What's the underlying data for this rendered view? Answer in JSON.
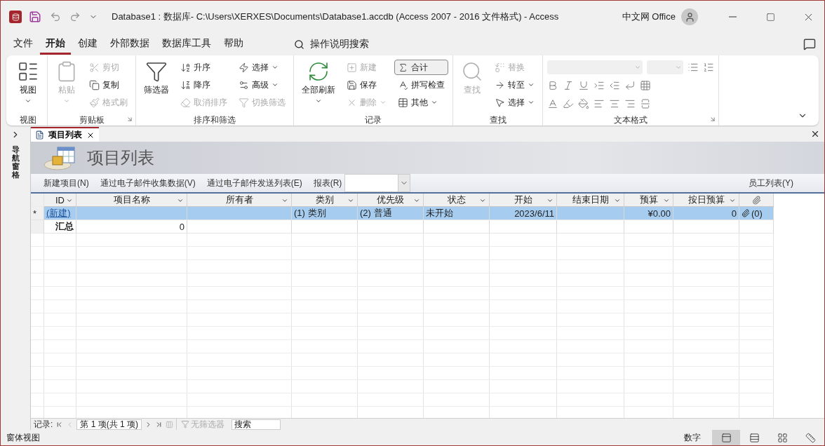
{
  "title_bar": {
    "title": "Database1 : 数据库- C:\\Users\\XERXES\\Documents\\Database1.accdb (Access 2007 - 2016 文件格式)  -  Access",
    "account": "中文网 Office"
  },
  "menu": {
    "tabs": [
      {
        "label": "文件",
        "selected": false
      },
      {
        "label": "开始",
        "selected": true
      },
      {
        "label": "创建",
        "selected": false
      },
      {
        "label": "外部数据",
        "selected": false
      },
      {
        "label": "数据库工具",
        "selected": false
      },
      {
        "label": "帮助",
        "selected": false
      }
    ],
    "search": "操作说明搜索"
  },
  "ribbon": {
    "groups": [
      {
        "kind": "buttons",
        "label": "视图",
        "launcher": false,
        "items": [
          {
            "kind": "large",
            "label": "视图",
            "dropdown": true,
            "disabled": false,
            "on": false
          }
        ]
      },
      {
        "kind": "buttons",
        "label": "剪贴板",
        "launcher": true,
        "items": [
          {
            "kind": "large",
            "label": "粘贴",
            "dropdown": true,
            "disabled": true,
            "on": false
          },
          {
            "kind": "small",
            "label": "剪切",
            "dropdown": false,
            "disabled": true,
            "on": false
          },
          {
            "kind": "small",
            "label": "复制",
            "dropdown": false,
            "disabled": false,
            "on": false
          },
          {
            "kind": "small",
            "label": "格式刷",
            "dropdown": false,
            "disabled": true,
            "on": false
          }
        ]
      },
      {
        "kind": "buttons",
        "label": "排序和筛选",
        "launcher": false,
        "items": [
          {
            "kind": "large",
            "label": "筛选器",
            "dropdown": false,
            "disabled": false,
            "on": false
          },
          {
            "kind": "small",
            "label": "升序",
            "dropdown": false,
            "disabled": false,
            "on": false
          },
          {
            "kind": "small",
            "label": "降序",
            "dropdown": false,
            "disabled": false,
            "on": false
          },
          {
            "kind": "small",
            "label": "取消排序",
            "dropdown": false,
            "disabled": true,
            "on": false
          },
          {
            "kind": "small",
            "label": "选择",
            "dropdown": true,
            "disabled": false,
            "on": false
          },
          {
            "kind": "small",
            "label": "高级",
            "dropdown": true,
            "disabled": false,
            "on": false
          },
          {
            "kind": "small",
            "label": "切换筛选",
            "dropdown": false,
            "disabled": true,
            "on": false
          }
        ]
      },
      {
        "kind": "buttons",
        "label": "记录",
        "launcher": false,
        "items": [
          {
            "kind": "large",
            "label": "全部刷新",
            "dropdown": true,
            "disabled": false,
            "on": false
          },
          {
            "kind": "small",
            "label": "新建",
            "dropdown": false,
            "disabled": true,
            "on": false
          },
          {
            "kind": "small",
            "label": "保存",
            "dropdown": false,
            "disabled": false,
            "on": false
          },
          {
            "kind": "small",
            "label": "删除",
            "dropdown": true,
            "disabled": true,
            "on": false
          },
          {
            "kind": "small",
            "label": "合计",
            "dropdown": false,
            "disabled": false,
            "on": true
          },
          {
            "kind": "small",
            "label": "拼写检查",
            "dropdown": false,
            "disabled": false,
            "on": false
          },
          {
            "kind": "small",
            "label": "其他",
            "dropdown": true,
            "disabled": false,
            "on": false
          }
        ]
      },
      {
        "kind": "buttons",
        "label": "查找",
        "launcher": false,
        "items": [
          {
            "kind": "large",
            "label": "查找",
            "dropdown": false,
            "disabled": true,
            "on": false
          },
          {
            "kind": "small",
            "label": "替换",
            "dropdown": false,
            "disabled": true,
            "on": false
          },
          {
            "kind": "small",
            "label": "转至",
            "dropdown": true,
            "disabled": false,
            "on": false
          },
          {
            "kind": "small",
            "label": "选择",
            "dropdown": true,
            "disabled": false,
            "on": false
          }
        ]
      },
      {
        "kind": "format",
        "label": "文本格式",
        "launcher": true
      }
    ]
  },
  "nav_pane": {
    "label": "导航窗格"
  },
  "document": {
    "tabs": [
      {
        "label": "项目列表",
        "selected": true
      }
    ],
    "form": {
      "title": "项目列表",
      "actions": [
        "新建项目(N)",
        "通过电子邮件收集数据(V)",
        "通过电子邮件发送列表(E)"
      ],
      "report_label": "报表(R)",
      "right_action": "员工列表(Y)"
    },
    "datasheet": {
      "columns": [
        {
          "kind": "text",
          "label": "ID"
        },
        {
          "kind": "text",
          "label": "项目名称"
        },
        {
          "kind": "text",
          "label": "所有者"
        },
        {
          "kind": "text",
          "label": "类别"
        },
        {
          "kind": "text",
          "label": "优先级"
        },
        {
          "kind": "text",
          "label": "状态"
        },
        {
          "kind": "text",
          "label": "开始"
        },
        {
          "kind": "text",
          "label": "结束日期"
        },
        {
          "kind": "text",
          "label": "预算"
        },
        {
          "kind": "text",
          "label": "按日预算"
        },
        {
          "kind": "attachment"
        }
      ],
      "rows": [
        {
          "marker": "*",
          "selected": true,
          "cells": [
            "(新建)",
            null,
            null,
            "(1) 类别",
            "(2) 普通",
            "未开始",
            "2023/6/11",
            null,
            "¥0.00",
            "0",
            "(0)"
          ]
        },
        {
          "selected": false,
          "cells": [
            "汇总",
            "0",
            null,
            null,
            null,
            null,
            null,
            null,
            null,
            null,
            null
          ]
        }
      ]
    }
  },
  "record_nav": {
    "label": "记录:",
    "position": "第 1 项(共 1 项)",
    "filter": "无筛选器",
    "filter_disabled": true,
    "search_placeholder": "搜索"
  },
  "status_bar": {
    "text": "窗体视图",
    "mode": "数字",
    "views": [
      {
        "selected": true
      },
      {
        "selected": false
      },
      {
        "selected": false
      },
      {
        "selected": false
      }
    ]
  }
}
